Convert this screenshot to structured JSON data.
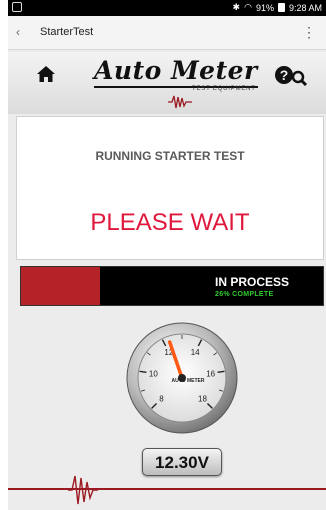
{
  "status_bar": {
    "battery": "91%",
    "time": "9:28 AM"
  },
  "title_bar": {
    "title": "StarterTest"
  },
  "logo": {
    "brand": "Auto Meter",
    "subtitle": "TEST EQUIPMENT"
  },
  "message": {
    "running": "RUNNING STARTER TEST",
    "wait": "PLEASE WAIT"
  },
  "progress": {
    "status": "IN PROCESS",
    "complete_text": "26% COMPLETE",
    "fraction": 0.26
  },
  "gauge": {
    "ticks": [
      "8",
      "10",
      "12",
      "14",
      "16",
      "18"
    ],
    "reading": 12.3,
    "min": 8,
    "max": 18,
    "brand_text": "AUTO METER"
  },
  "voltage": {
    "label": "12.30V"
  },
  "colors": {
    "accent_red": "#e0183c",
    "progress_red": "#b52228",
    "needle": "#ff5a14",
    "complete_green": "#2ecc2e"
  },
  "icons": {
    "home": "home-icon",
    "help": "help-search-icon",
    "menu": "overflow-menu-icon",
    "back": "back-icon"
  }
}
